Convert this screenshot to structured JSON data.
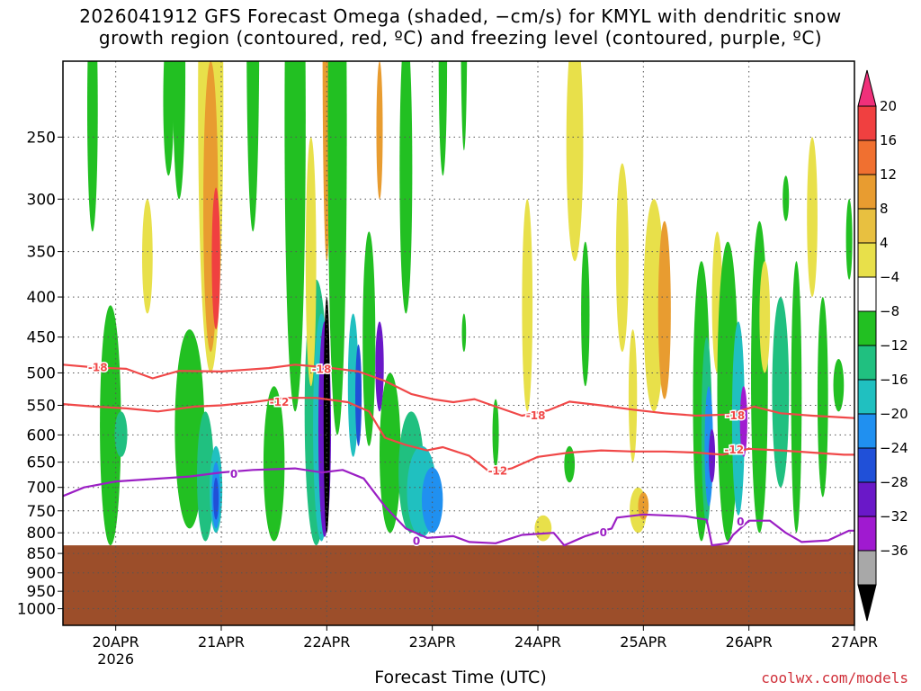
{
  "chart_data": {
    "type": "heatmap",
    "title_line1": "2026041912 GFS Forecast Omega (shaded, −cm/s) for KMYL with dendritic snow",
    "title_line2": "growth region (contoured, red, ºC) and freezing level (contoured, purple, ºC)",
    "xlabel": "Forecast Time (UTC)",
    "credit": "coolwx.com/models",
    "y_axis": {
      "scale": "log-pressure",
      "range": [
        1050,
        200
      ],
      "ticks": [
        250,
        300,
        350,
        400,
        450,
        500,
        550,
        600,
        650,
        700,
        750,
        800,
        850,
        900,
        950,
        1000
      ]
    },
    "x_axis": {
      "range_days": [
        19.5,
        27.0
      ],
      "ticks": [
        {
          "day": 20,
          "label": "20APR",
          "sublabel": "2026"
        },
        {
          "day": 21,
          "label": "21APR",
          "sublabel": ""
        },
        {
          "day": 22,
          "label": "22APR",
          "sublabel": ""
        },
        {
          "day": 23,
          "label": "23APR",
          "sublabel": ""
        },
        {
          "day": 24,
          "label": "24APR",
          "sublabel": ""
        },
        {
          "day": 25,
          "label": "25APR",
          "sublabel": ""
        },
        {
          "day": 26,
          "label": "26APR",
          "sublabel": ""
        },
        {
          "day": 27,
          "label": "27APR",
          "sublabel": ""
        }
      ]
    },
    "colorbar": {
      "labels": [
        "20",
        "16",
        "12",
        "8",
        "4",
        "−4",
        "−8",
        "−12",
        "−16",
        "−20",
        "−24",
        "−28",
        "−32",
        "−36"
      ],
      "colors": [
        "#f0307a",
        "#f04040",
        "#f07030",
        "#e89c30",
        "#e8c040",
        "#e8e04a",
        "#ffffff",
        "#22c022",
        "#20c080",
        "#20c0c0",
        "#2090f0",
        "#2050d8",
        "#6a18c8",
        "#a01ad0",
        "#a8a8a8",
        "#000000"
      ]
    },
    "ground_pressure_hpa": 830,
    "ground_color": "#9c4e2a",
    "contours": [
      {
        "name": "-18",
        "color": "#f04848",
        "labels": [
          {
            "label": "-18",
            "day": 19.83,
            "p": 492
          },
          {
            "label": "-18",
            "day": 21.95,
            "p": 495
          },
          {
            "label": "-18",
            "day": 23.98,
            "p": 567
          },
          {
            "label": "-18",
            "day": 25.87,
            "p": 567
          }
        ],
        "points": [
          [
            19.5,
            488
          ],
          [
            19.8,
            492
          ],
          [
            20.1,
            494
          ],
          [
            20.35,
            508
          ],
          [
            20.6,
            497
          ],
          [
            21.0,
            498
          ],
          [
            21.45,
            493
          ],
          [
            21.7,
            488
          ],
          [
            22.0,
            492
          ],
          [
            22.3,
            498
          ],
          [
            22.55,
            512
          ],
          [
            22.8,
            532
          ],
          [
            23.0,
            540
          ],
          [
            23.2,
            545
          ],
          [
            23.4,
            540
          ],
          [
            23.6,
            552
          ],
          [
            23.85,
            567
          ],
          [
            24.1,
            558
          ],
          [
            24.3,
            544
          ],
          [
            24.6,
            550
          ],
          [
            24.9,
            557
          ],
          [
            25.2,
            563
          ],
          [
            25.5,
            567
          ],
          [
            25.8,
            565
          ],
          [
            26.05,
            552
          ],
          [
            26.3,
            563
          ],
          [
            26.6,
            567
          ],
          [
            26.9,
            570
          ],
          [
            27.0,
            571
          ]
        ]
      },
      {
        "name": "-12",
        "color": "#f04848",
        "labels": [
          {
            "label": "-12",
            "day": 21.55,
            "p": 545
          },
          {
            "label": "-12",
            "day": 23.62,
            "p": 667
          },
          {
            "label": "-12",
            "day": 25.86,
            "p": 627
          }
        ],
        "points": [
          [
            19.5,
            548
          ],
          [
            19.8,
            552
          ],
          [
            20.1,
            555
          ],
          [
            20.4,
            560
          ],
          [
            20.75,
            552
          ],
          [
            21.0,
            550
          ],
          [
            21.3,
            545
          ],
          [
            21.6,
            538
          ],
          [
            21.9,
            538
          ],
          [
            22.2,
            545
          ],
          [
            22.4,
            560
          ],
          [
            22.55,
            605
          ],
          [
            22.75,
            618
          ],
          [
            22.95,
            628
          ],
          [
            23.1,
            622
          ],
          [
            23.35,
            638
          ],
          [
            23.55,
            670
          ],
          [
            23.75,
            662
          ],
          [
            24.0,
            640
          ],
          [
            24.3,
            632
          ],
          [
            24.6,
            628
          ],
          [
            24.9,
            630
          ],
          [
            25.2,
            630
          ],
          [
            25.5,
            632
          ],
          [
            25.75,
            636
          ],
          [
            26.0,
            625
          ],
          [
            26.3,
            628
          ],
          [
            26.6,
            632
          ],
          [
            26.9,
            636
          ],
          [
            27.0,
            636
          ]
        ]
      },
      {
        "name": "0",
        "color": "#9b1fc4",
        "labels": [
          {
            "label": "0",
            "day": 21.12,
            "p": 673
          },
          {
            "label": "0",
            "day": 22.85,
            "p": 820
          },
          {
            "label": "0",
            "day": 24.62,
            "p": 800
          },
          {
            "label": "0",
            "day": 25.92,
            "p": 775
          }
        ],
        "points": [
          [
            19.5,
            718
          ],
          [
            19.7,
            700
          ],
          [
            20.0,
            688
          ],
          [
            20.35,
            683
          ],
          [
            20.7,
            678
          ],
          [
            21.0,
            670
          ],
          [
            21.3,
            665
          ],
          [
            21.7,
            662
          ],
          [
            21.95,
            670
          ],
          [
            22.15,
            665
          ],
          [
            22.35,
            682
          ],
          [
            22.55,
            740
          ],
          [
            22.75,
            790
          ],
          [
            22.95,
            812
          ],
          [
            23.2,
            808
          ],
          [
            23.35,
            822
          ],
          [
            23.6,
            825
          ],
          [
            23.85,
            805
          ],
          [
            24.15,
            800
          ],
          [
            24.25,
            830
          ],
          [
            24.45,
            808
          ],
          [
            24.62,
            795
          ],
          [
            24.7,
            790
          ],
          [
            24.75,
            765
          ],
          [
            25.0,
            758
          ],
          [
            25.4,
            762
          ],
          [
            25.6,
            770
          ],
          [
            25.65,
            830
          ],
          [
            25.8,
            825
          ],
          [
            25.85,
            805
          ],
          [
            26.0,
            772
          ],
          [
            26.2,
            772
          ],
          [
            26.35,
            800
          ],
          [
            26.5,
            822
          ],
          [
            26.75,
            818
          ],
          [
            26.95,
            795
          ],
          [
            27.0,
            795
          ]
        ]
      }
    ]
  }
}
